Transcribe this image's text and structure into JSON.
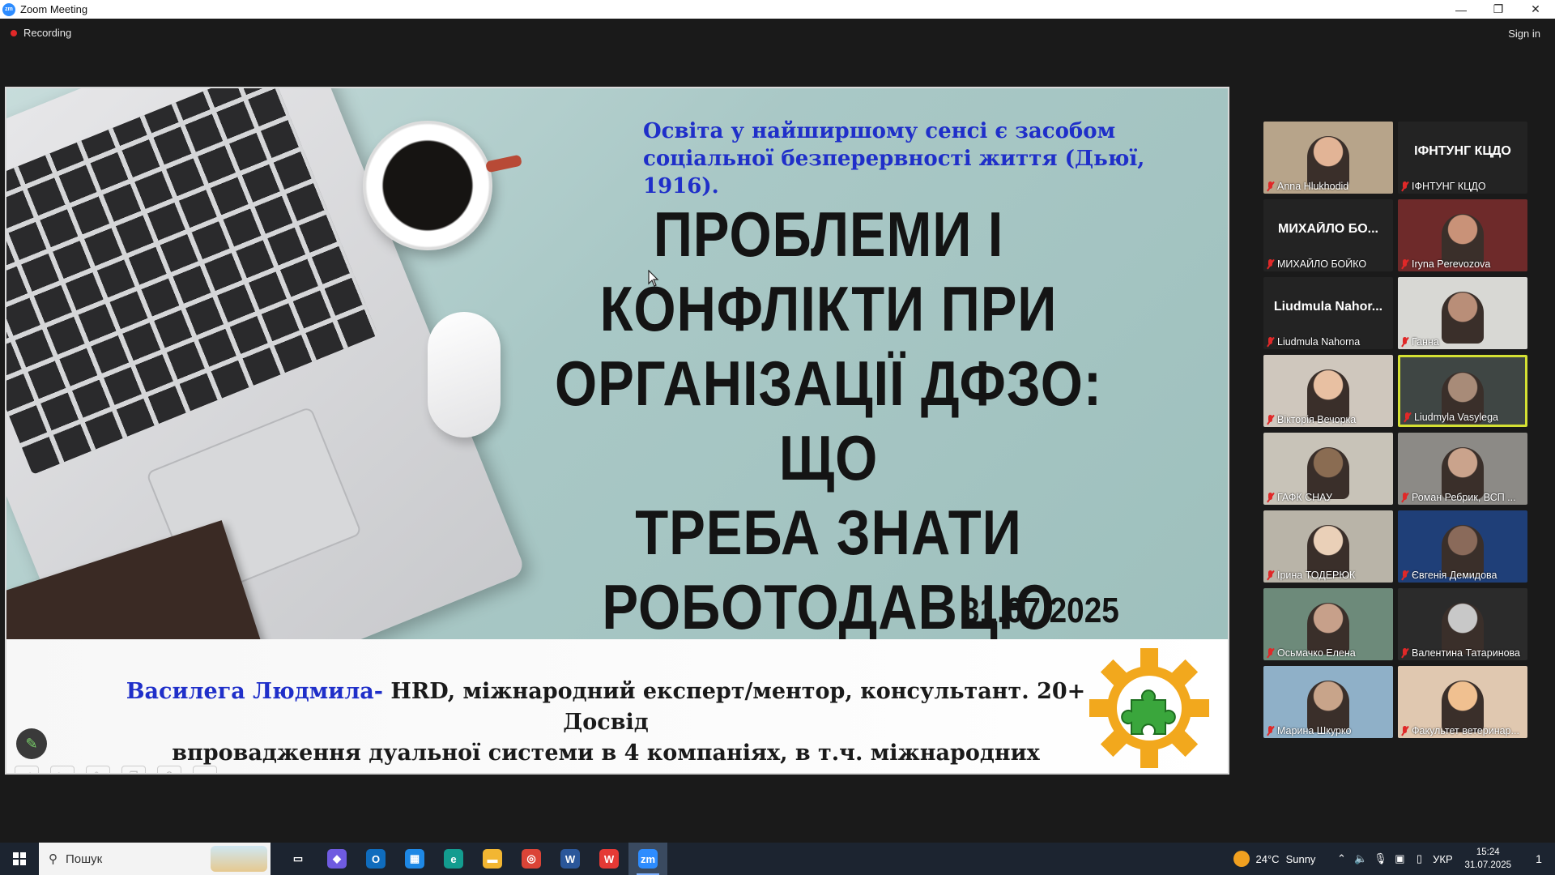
{
  "window": {
    "app_icon": "zm",
    "title": "Zoom Meeting",
    "minimize_icon": "minimize-icon",
    "restore_icon": "restore-icon",
    "close_icon": "close-icon"
  },
  "meeting_bar": {
    "recording_label": "Recording",
    "signin_label": "Sign in"
  },
  "slide": {
    "quote": "Освіта у найширшому сенсі є засобом соціальної безперервності життя (Дьюї, 1916).",
    "title_lines": [
      "ПРОБЛЕМИ І",
      "КОНФЛІКТИ ПРИ",
      "ОРГАНІЗАЦІЇ ДФЗО: ЩО",
      "ТРЕБА ЗНАТИ",
      "РОБОТОДАВЦЮ"
    ],
    "date": "31.07.2025",
    "speaker_name": "Василега Людмила-",
    "speaker_desc_1": " HRD, міжнародний експерт/ментор, консультант. 20+ Досвід",
    "speaker_desc_2": "впровадження дуальної системи в 4 компаніях, в т.ч. міжнародних"
  },
  "annotation": {
    "pen_icon": "pen-icon"
  },
  "participants": [
    {
      "label": "Anna Hlukhodid",
      "big_name": "",
      "video": true,
      "bg": "#b7a48a",
      "skin": "#e2b496"
    },
    {
      "label": "ІФНТУНГ КЦДО",
      "big_name": "ІФНТУНГ КЦДО",
      "video": false
    },
    {
      "label": "МИХАЙЛО БОЙКО",
      "big_name": "МИХАЙЛО БО...",
      "video": false
    },
    {
      "label": "Iryna Perevozova",
      "big_name": "",
      "video": true,
      "bg": "#6e2a2a",
      "skin": "#c99278"
    },
    {
      "label": "Liudmula Nahorna",
      "big_name": "Liudmula Nahor...",
      "video": false
    },
    {
      "label": "Ганна",
      "big_name": "",
      "video": true,
      "bg": "#d8d8d4",
      "skin": "#b98e78"
    },
    {
      "label": "Вікторія Вечорка",
      "big_name": "",
      "video": true,
      "bg": "#cfc7bd",
      "skin": "#e8c0a2"
    },
    {
      "label": "Liudmyla Vasylega",
      "big_name": "",
      "video": true,
      "bg": "#3f4644",
      "skin": "#a88b78",
      "active": true
    },
    {
      "label": "ГАФК СНАУ",
      "big_name": "",
      "video": true,
      "bg": "#c8c3b8",
      "skin": "#8a6c52"
    },
    {
      "label": "Роман Ребрик, ВСП ...",
      "big_name": "",
      "video": true,
      "bg": "#8c8a86",
      "skin": "#caa38c"
    },
    {
      "label": "Ірина ТОДЕРЮК",
      "big_name": "",
      "video": true,
      "bg": "#b9b4a8",
      "skin": "#ead0b8"
    },
    {
      "label": "Євгенія Демидова",
      "big_name": "",
      "video": true,
      "bg": "#1f3f78",
      "skin": "#8a6a5a"
    },
    {
      "label": "Осьмачко Елена",
      "big_name": "",
      "video": true,
      "bg": "#6d8a7a",
      "skin": "#c7a08a"
    },
    {
      "label": "Валентина Татаринова",
      "big_name": "",
      "video": true,
      "bg": "#2b2b2b",
      "skin": "#c8c8c8"
    },
    {
      "label": "Марина Шкурко",
      "big_name": "",
      "video": true,
      "bg": "#8fb0c8",
      "skin": "#c8a48a"
    },
    {
      "label": "Факультет ветеринар...",
      "big_name": "",
      "video": true,
      "bg": "#e0c8b0",
      "skin": "#f0c090"
    }
  ],
  "taskbar": {
    "search_placeholder": "Пошук",
    "apps": [
      {
        "name": "task-view-icon",
        "glyph": "▭",
        "color": "#1c2430"
      },
      {
        "name": "copilot-icon",
        "glyph": "◆",
        "color": "#6f5be0"
      },
      {
        "name": "outlook-icon",
        "glyph": "O",
        "color": "#0f6cbd"
      },
      {
        "name": "store-icon",
        "glyph": "▦",
        "color": "#1e88e5"
      },
      {
        "name": "edge-icon",
        "glyph": "e",
        "color": "#139c8f"
      },
      {
        "name": "explorer-icon",
        "glyph": "▬",
        "color": "#f2b632"
      },
      {
        "name": "chrome-icon",
        "glyph": "◎",
        "color": "#db4437"
      },
      {
        "name": "word-icon",
        "glyph": "W",
        "color": "#2b579a"
      },
      {
        "name": "wps-icon",
        "glyph": "W",
        "color": "#e53935"
      },
      {
        "name": "zoom-icon",
        "glyph": "zm",
        "color": "#2d8cff",
        "active": true
      }
    ],
    "weather_temp": "24°C",
    "weather_desc": "Sunny",
    "language": "УКР",
    "time": "15:24",
    "date": "31.07.2025",
    "notification_count": "1"
  }
}
